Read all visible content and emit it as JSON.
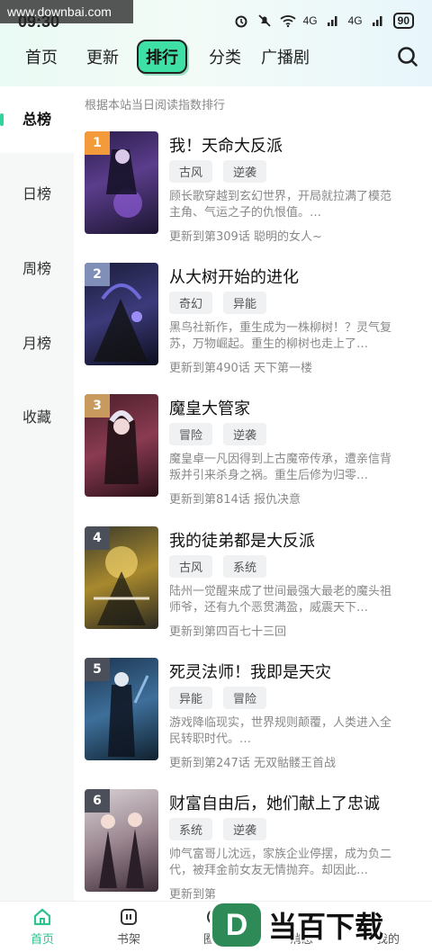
{
  "watermark": "www.downbai.com",
  "status": {
    "time": "09:30",
    "battery": "90",
    "net1": "4G",
    "net2": "4G"
  },
  "nav": {
    "tabs": [
      "首页",
      "更新",
      "排行",
      "分类",
      "广播剧"
    ],
    "active_index": 2
  },
  "sidebar": {
    "items": [
      "总榜",
      "日榜",
      "周榜",
      "月榜",
      "收藏"
    ],
    "active_index": 0
  },
  "subtitle": "根据本站当日阅读指数排行",
  "list": [
    {
      "rank": "1",
      "rank_color": "#f39a3a",
      "title": "我！天命大反派",
      "tags": [
        "古风",
        "逆袭"
      ],
      "desc": "顾长歌穿越到玄幻世界，开局就拉满了模范主角、气运之子的仇恨值。…",
      "update": "更新到第309话 聪明的女人~"
    },
    {
      "rank": "2",
      "rank_color": "#7f8fb8",
      "title": "从大树开始的进化",
      "tags": [
        "奇幻",
        "异能"
      ],
      "desc": "黑鸟社新作，重生成为一株柳树！？灵气复苏，万物崛起。重生的柳树也走上了…",
      "update": "更新到第490话 天下第一楼"
    },
    {
      "rank": "3",
      "rank_color": "#c99a5e",
      "title": "魔皇大管家",
      "tags": [
        "冒险",
        "逆袭"
      ],
      "desc": "魔皇卓一凡因得到上古魔帝传承，遭亲信背叛并引来杀身之祸。重生后修为归零…",
      "update": "更新到第814话 报仇决意"
    },
    {
      "rank": "4",
      "rank_color": "#4a4f5a",
      "title": "我的徒弟都是大反派",
      "tags": [
        "古风",
        "系统"
      ],
      "desc": "陆州一觉醒来成了世间最强大最老的魔头祖师爷，还有九个恶贯满盈，威震天下…",
      "update": "更新到第四百七十三回"
    },
    {
      "rank": "5",
      "rank_color": "#4a4f5a",
      "title": "死灵法师！我即是天灾",
      "tags": [
        "异能",
        "冒险"
      ],
      "desc": "游戏降临现实，世界规则颠覆，人类进入全民转职时代。…",
      "update": "更新到第247话 无双骷髅王首战"
    },
    {
      "rank": "6",
      "rank_color": "#4a4f5a",
      "title": "财富自由后，她们献上了忠诚",
      "tags": [
        "系统",
        "逆袭"
      ],
      "desc": "帅气富哥儿沈远，家族企业停摆，成为负二代，被拜金前女友无情抛弃。却因此…",
      "update": "更新到第"
    }
  ],
  "bottom_nav": {
    "items": [
      "首页",
      "书架",
      "圈子",
      "消息",
      "我的"
    ],
    "active_index": 0
  },
  "logo": {
    "letter": "D",
    "text": "当百下载"
  }
}
